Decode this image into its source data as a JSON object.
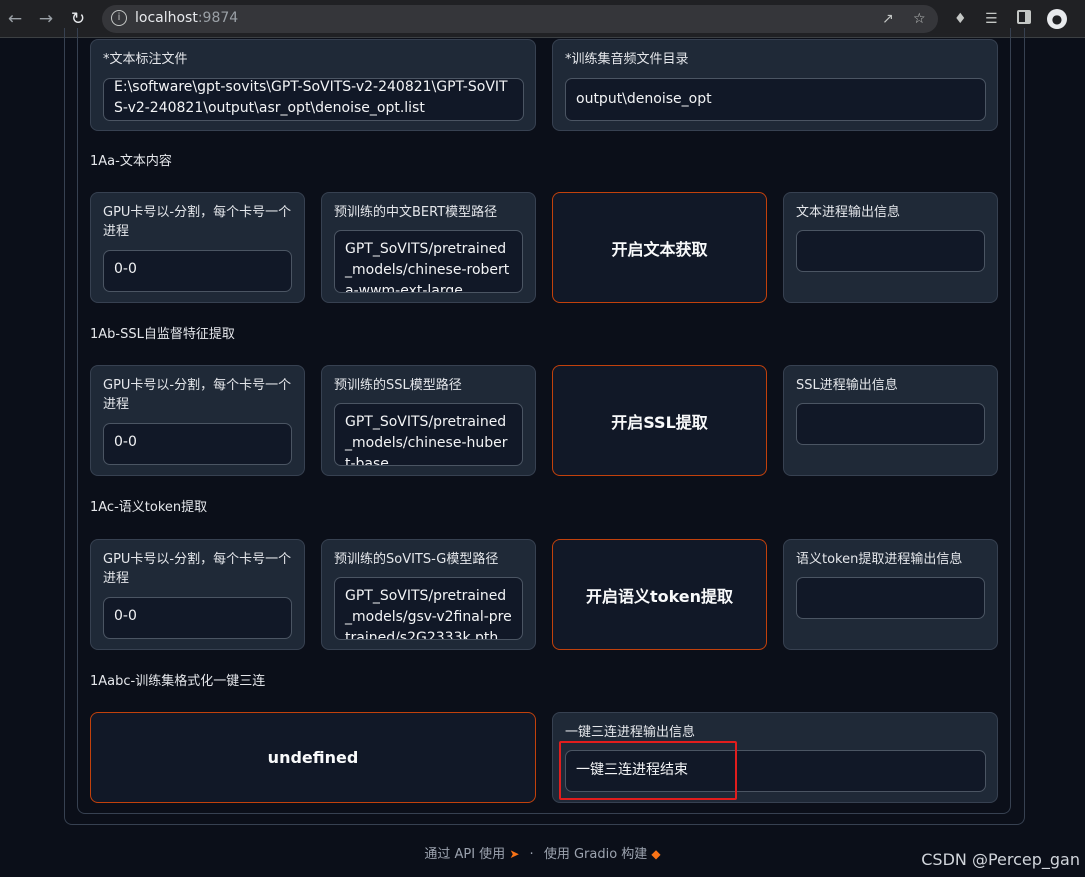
{
  "browser": {
    "url_host": "localhost",
    "url_port": ":9874",
    "icons": [
      "back-arrow-icon",
      "forward-arrow-icon",
      "reload-icon",
      "info-icon",
      "share-icon",
      "star-icon",
      "extensions-icon",
      "media-icon",
      "sidepanel-icon",
      "profile-icon"
    ]
  },
  "top": {
    "text_label_file_label": "*文本标注文件",
    "text_label_file_value": "E:\\software\\gpt-sovits\\GPT-SoVITS-v2-240821\\GPT-SoVITS-v2-240821\\output\\asr_opt\\denoise_opt.list",
    "audio_dir_label": "*训练集音频文件目录",
    "audio_dir_value": "output\\denoise_opt"
  },
  "sections": [
    {
      "title": "1Aa-文本内容",
      "gpu_label": "GPU卡号以-分割，每个卡号一个进程",
      "gpu_value": "0-0",
      "model_label": "预训练的中文BERT模型路径",
      "model_value": "GPT_SoVITS/pretrained_models/chinese-roberta-wwm-ext-large",
      "button": "开启文本获取",
      "output_label": "文本进程输出信息",
      "output_value": ""
    },
    {
      "title": "1Ab-SSL自监督特征提取",
      "gpu_label": "GPU卡号以-分割，每个卡号一个进程",
      "gpu_value": "0-0",
      "model_label": "预训练的SSL模型路径",
      "model_value": "GPT_SoVITS/pretrained_models/chinese-hubert-base",
      "button": "开启SSL提取",
      "output_label": "SSL进程输出信息",
      "output_value": ""
    },
    {
      "title": "1Ac-语义token提取",
      "gpu_label": "GPU卡号以-分割，每个卡号一个进程",
      "gpu_value": "0-0",
      "model_label": "预训练的SoVITS-G模型路径",
      "model_value": "GPT_SoVITS/pretrained_models/gsv-v2final-pretrained/s2G2333k.pth",
      "button": "开启语义token提取",
      "output_label": "语义token提取进程输出信息",
      "output_value": ""
    }
  ],
  "oneclick": {
    "title": "1Aabc-训练集格式化一键三连",
    "button": "undefined",
    "output_label": "一键三连进程输出信息",
    "output_value": "一键三连进程结束"
  },
  "footer": {
    "api_text": "通过 API 使用",
    "separator": "·",
    "gradio_text": "使用 Gradio 构建"
  },
  "watermark": "CSDN @Percep_gan",
  "colors": {
    "background": "#0b0f19",
    "card": "#1f2937",
    "accent_border": "#c2410c",
    "highlight": "#e11d1d"
  }
}
